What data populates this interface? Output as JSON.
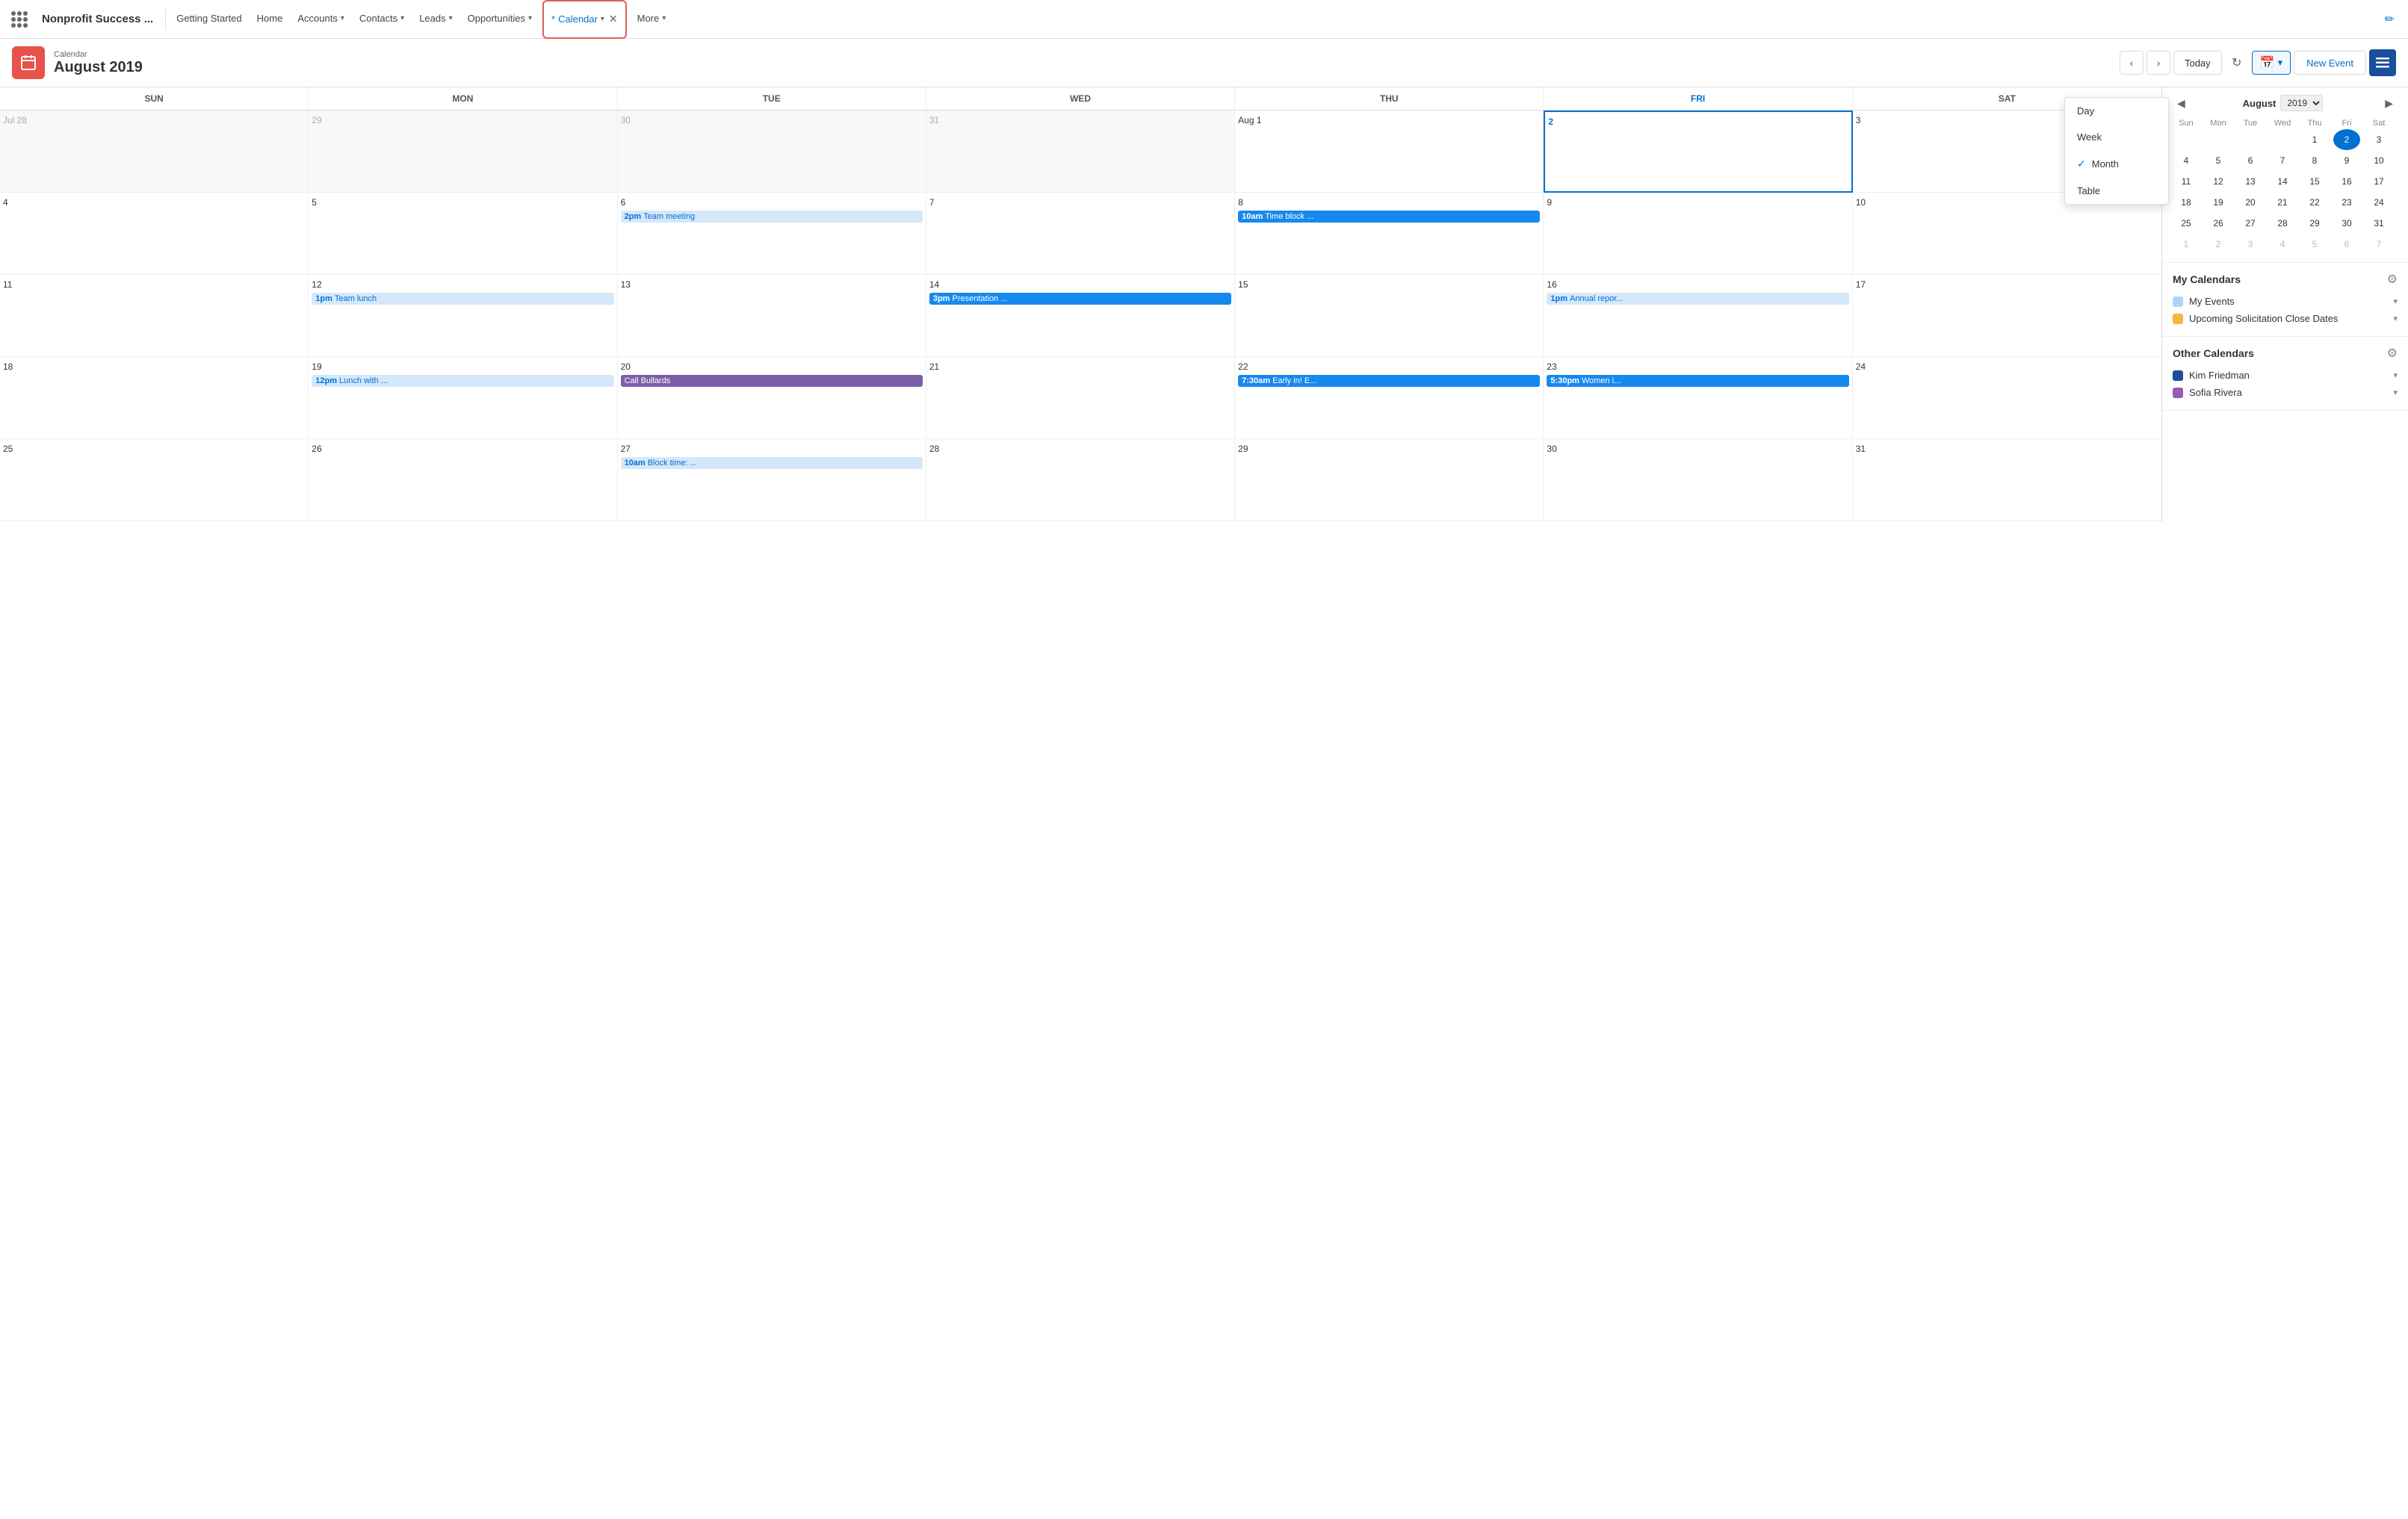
{
  "app": {
    "name": "Nonprofit Success ...",
    "nav_items": [
      {
        "id": "getting-started",
        "label": "Getting Started"
      },
      {
        "id": "home",
        "label": "Home"
      },
      {
        "id": "accounts",
        "label": "Accounts",
        "hasChevron": true
      },
      {
        "id": "contacts",
        "label": "Contacts",
        "hasChevron": true
      },
      {
        "id": "leads",
        "label": "Leads",
        "hasChevron": true
      },
      {
        "id": "opportunities",
        "label": "Opportunities",
        "hasChevron": true
      },
      {
        "id": "calendar",
        "label": "Calendar",
        "hasChevron": true,
        "active": true
      },
      {
        "id": "more",
        "label": "More",
        "hasChevron": true
      }
    ]
  },
  "calendar": {
    "label": "Calendar",
    "month": "August 2019",
    "today_btn": "Today",
    "new_event_btn": "New Event",
    "view_options": [
      "Day",
      "Week",
      "Month",
      "Table"
    ],
    "current_view": "Month"
  },
  "day_headers": [
    "SUN",
    "MON",
    "TUE",
    "WED",
    "THU",
    "FRI",
    "SAT"
  ],
  "weeks": [
    [
      {
        "date": "Jul 28",
        "other": true,
        "events": []
      },
      {
        "date": "29",
        "other": true,
        "events": []
      },
      {
        "date": "30",
        "other": true,
        "events": []
      },
      {
        "date": "31",
        "other": true,
        "events": []
      },
      {
        "date": "Aug 1",
        "events": []
      },
      {
        "date": "2",
        "today": true,
        "events": []
      },
      {
        "date": "3",
        "events": []
      }
    ],
    [
      {
        "date": "4",
        "events": []
      },
      {
        "date": "5",
        "events": []
      },
      {
        "date": "6",
        "events": [
          {
            "time": "2pm",
            "title": "Team meeting",
            "type": "blue"
          }
        ]
      },
      {
        "date": "7",
        "events": []
      },
      {
        "date": "8",
        "events": [
          {
            "time": "10am",
            "title": "Time block ...",
            "type": "teal"
          }
        ]
      },
      {
        "date": "9",
        "events": []
      },
      {
        "date": "10",
        "events": []
      }
    ],
    [
      {
        "date": "11",
        "events": []
      },
      {
        "date": "12",
        "events": [
          {
            "time": "1pm",
            "title": "Team lunch",
            "type": "blue"
          }
        ]
      },
      {
        "date": "13",
        "events": []
      },
      {
        "date": "14",
        "events": [
          {
            "time": "3pm",
            "title": "Presentation ...",
            "type": "teal"
          }
        ]
      },
      {
        "date": "15",
        "events": []
      },
      {
        "date": "16",
        "events": [
          {
            "time": "1pm",
            "title": "Annual repor...",
            "type": "blue"
          }
        ]
      },
      {
        "date": "17",
        "events": []
      }
    ],
    [
      {
        "date": "18",
        "events": []
      },
      {
        "date": "19",
        "events": [
          {
            "time": "12pm",
            "title": "Lunch with ...",
            "type": "blue"
          }
        ]
      },
      {
        "date": "20",
        "events": [
          {
            "time": "",
            "title": "Call Bullards",
            "type": "purple"
          }
        ]
      },
      {
        "date": "21",
        "events": []
      },
      {
        "date": "22",
        "events": [
          {
            "time": "7:30am",
            "title": "Early in! E...",
            "type": "teal"
          }
        ]
      },
      {
        "date": "23",
        "events": [
          {
            "time": "5:30pm",
            "title": "Women i...",
            "type": "teal"
          }
        ]
      },
      {
        "date": "24",
        "events": []
      }
    ],
    [
      {
        "date": "25",
        "events": []
      },
      {
        "date": "26",
        "events": []
      },
      {
        "date": "27",
        "events": [
          {
            "time": "10am",
            "title": "Block time: ...",
            "type": "blue"
          }
        ]
      },
      {
        "date": "28",
        "events": []
      },
      {
        "date": "29",
        "events": []
      },
      {
        "date": "30",
        "events": []
      },
      {
        "date": "31",
        "events": []
      }
    ]
  ],
  "mini_calendar": {
    "month": "August",
    "year": "2019",
    "day_headers": [
      "Sun",
      "Mon",
      "Tue",
      "Wed",
      "Thu",
      "Fri",
      "Sat"
    ],
    "weeks": [
      [
        {
          "day": "",
          "other": true
        },
        {
          "day": "",
          "other": true
        },
        {
          "day": "",
          "other": true
        },
        {
          "day": "",
          "other": true
        },
        {
          "day": "1"
        },
        {
          "day": "2",
          "today": true
        },
        {
          "day": "3"
        }
      ],
      [
        {
          "day": "4"
        },
        {
          "day": "5"
        },
        {
          "day": "6"
        },
        {
          "day": "7"
        },
        {
          "day": "8"
        },
        {
          "day": "9"
        },
        {
          "day": "10"
        }
      ],
      [
        {
          "day": "11"
        },
        {
          "day": "12"
        },
        {
          "day": "13"
        },
        {
          "day": "14"
        },
        {
          "day": "15"
        },
        {
          "day": "16"
        },
        {
          "day": "17"
        }
      ],
      [
        {
          "day": "18"
        },
        {
          "day": "19"
        },
        {
          "day": "20"
        },
        {
          "day": "21"
        },
        {
          "day": "22"
        },
        {
          "day": "23"
        },
        {
          "day": "24"
        }
      ],
      [
        {
          "day": "25"
        },
        {
          "day": "26"
        },
        {
          "day": "27"
        },
        {
          "day": "28"
        },
        {
          "day": "29"
        },
        {
          "day": "30"
        },
        {
          "day": "31"
        }
      ],
      [
        {
          "day": "1",
          "other": true
        },
        {
          "day": "2",
          "other": true
        },
        {
          "day": "3",
          "other": true
        },
        {
          "day": "4",
          "other": true
        },
        {
          "day": "5",
          "other": true
        },
        {
          "day": "6",
          "other": true
        },
        {
          "day": "7",
          "other": true
        }
      ]
    ]
  },
  "my_calendars": {
    "title": "My Calendars",
    "items": [
      {
        "name": "My Events",
        "color": "#b0d4f5"
      },
      {
        "name": "Upcoming Solicitation Close Dates",
        "color": "#f4b842"
      }
    ]
  },
  "other_calendars": {
    "title": "Other Calendars",
    "items": [
      {
        "name": "Kim Friedman",
        "color": "#1b4f9e"
      },
      {
        "name": "Sofia Rivera",
        "color": "#9b59b6"
      }
    ]
  },
  "view_dropdown": {
    "items": [
      "Day",
      "Week",
      "Month",
      "Table"
    ],
    "selected": "Month"
  }
}
